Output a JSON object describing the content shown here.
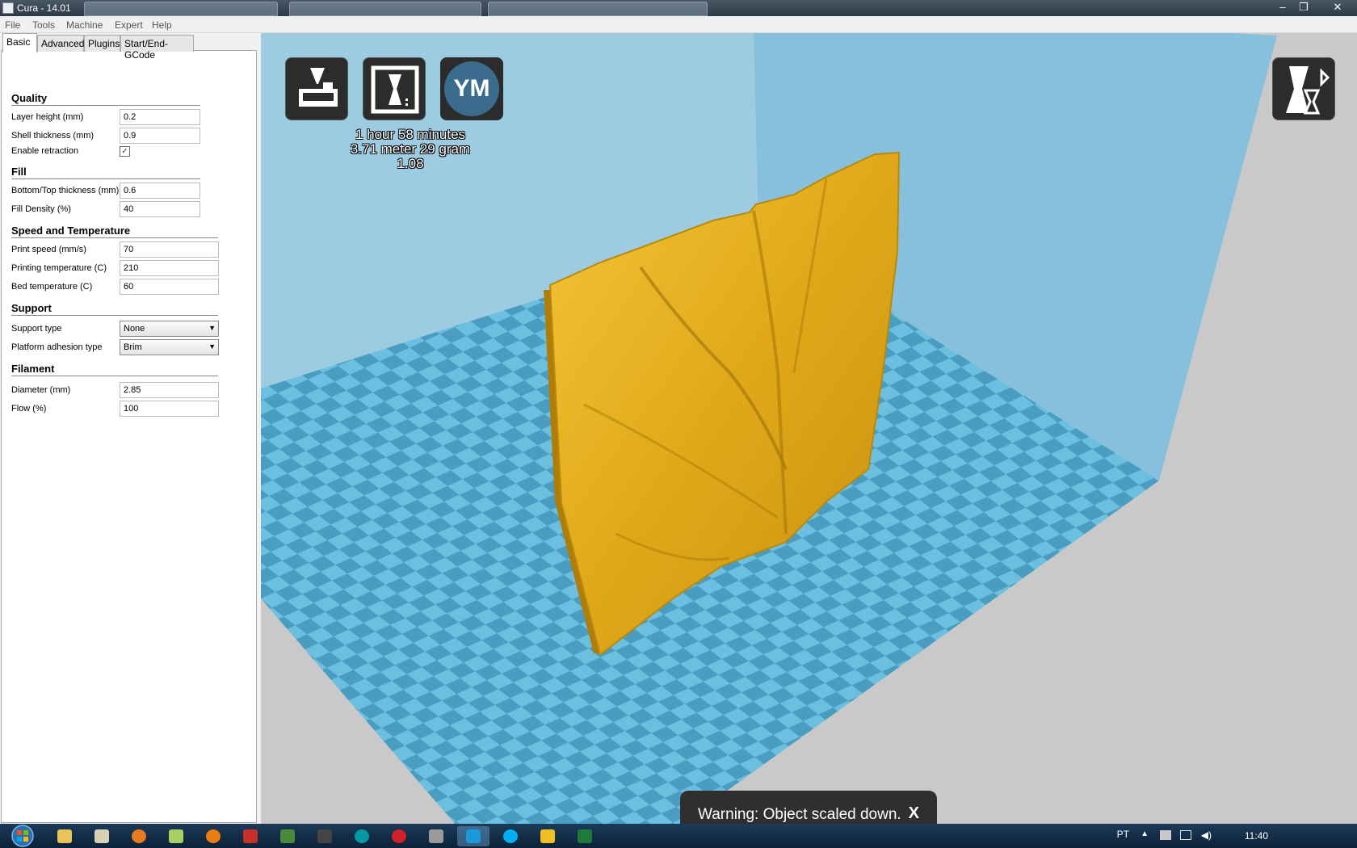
{
  "window": {
    "title": "Cura - 14.01",
    "minimize": "–",
    "maximize": "❐",
    "close": "✕"
  },
  "menu": [
    "File",
    "Tools",
    "Machine",
    "Expert",
    "Help"
  ],
  "tabs": [
    "Basic",
    "Advanced",
    "Plugins",
    "Start/End-GCode"
  ],
  "quality": {
    "heading": "Quality",
    "layer_height_label": "Layer height (mm)",
    "layer_height": "0.2",
    "shell_thickness_label": "Shell thickness (mm)",
    "shell_thickness": "0.9",
    "retraction_label": "Enable retraction",
    "retraction_mark": "✓"
  },
  "fill": {
    "heading": "Fill",
    "bottom_top_label": "Bottom/Top thickness (mm)",
    "bottom_top": "0.6",
    "density_label": "Fill Density (%)",
    "density": "40"
  },
  "speed": {
    "heading": "Speed and Temperature",
    "print_speed_label": "Print speed (mm/s)",
    "print_speed": "70",
    "print_temp_label": "Printing temperature (C)",
    "print_temp": "210",
    "bed_temp_label": "Bed temperature (C)",
    "bed_temp": "60"
  },
  "support": {
    "heading": "Support",
    "type_label": "Support type",
    "type": "None",
    "adhesion_label": "Platform adhesion type",
    "adhesion": "Brim"
  },
  "filament": {
    "heading": "Filament",
    "diameter_label": "Diameter (mm)",
    "diameter": "2.85",
    "flow_label": "Flow (%)",
    "flow": "100"
  },
  "print_info": {
    "time": "1 hour 58 minutes",
    "material": "3.71 meter 29 gram",
    "cost": "1.08"
  },
  "ym_label": "YM",
  "warning": {
    "text": "Warning: Object scaled down.",
    "close": "X"
  },
  "tray": {
    "language": "PT",
    "time": "11:40"
  },
  "colors": {
    "model": "#f0b520",
    "bed_light": "#6dbfdf",
    "bed_dark": "#4a9dc0",
    "wall": "#8ec6e0"
  }
}
